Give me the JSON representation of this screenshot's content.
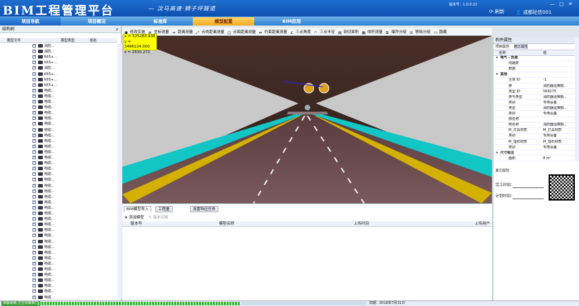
{
  "header": {
    "logo": "BIM工程管理平台",
    "slogan": "— 汶马高速·狮子坪隧道",
    "version": "版本号：1.0.0.22",
    "refresh": "刷新",
    "user": "成都砼信001",
    "win_min": "—",
    "win_max": "□",
    "win_close": "✕"
  },
  "nav": {
    "tabs": [
      {
        "label": "项目导航"
      },
      {
        "label": "项目概况"
      },
      {
        "label": "标准库"
      },
      {
        "label": "模型配置"
      },
      {
        "label": "BIM应用"
      }
    ],
    "selected": "模型配置"
  },
  "left": {
    "title": "结构树",
    "search": "",
    "cols": [
      "模型文件",
      "模型类型",
      "组名"
    ],
    "rows": [
      "消防...",
      "消防...",
      "K65+...",
      "K65+...",
      "消防...",
      "K65+...",
      "K65+...",
      "K65+...",
      "电缆...",
      "电缆...",
      "电缆...",
      "电缆...",
      "电缆...",
      "电缆...",
      "电缆...",
      "电缆...",
      "电缆...",
      "电缆...",
      "电缆...",
      "电缆...",
      "电缆...",
      "电缆...",
      "电缆...",
      "电缆...",
      "电缆...",
      "电缆...",
      "电缆...",
      "电缆...",
      "电缆...",
      "电缆...",
      "电缆...",
      "电缆...",
      "电缆...",
      "电缆...",
      "电缆...",
      "电缆...",
      "电缆...",
      "电缆...",
      "电缆...",
      "电缆...",
      "电缆...",
      "电缆...",
      "电缆...",
      "电缆...",
      "电缆...",
      "电缆..."
    ]
  },
  "toolbar": [
    "修改实施",
    "坐标测量",
    "距离测量",
    "点线距离测量",
    "点面距离测量",
    "约束距离测量",
    "三点角度",
    "三点半径",
    "剖切面积",
    "体积测量",
    "爆炸分组",
    "移除分组",
    "隐藏"
  ],
  "coords": {
    "x": "x = 525283.938",
    "y": "y = 3496124.000",
    "z": "z = 2630.272"
  },
  "props": {
    "panel_title": "构件属性",
    "tabs": [
      "项目属性",
      "施工属性"
    ],
    "cols": [
      "名称",
      "值"
    ],
    "rows": [
      {
        "k": "电气 - 负荷",
        "v": "",
        "g": true
      },
      {
        "k": "线路数",
        "v": ""
      },
      {
        "k": "数据",
        "v": ""
      },
      {
        "k": "其他",
        "v": "",
        "g": true
      },
      {
        "k": "主体 ID",
        "v": "-1"
      },
      {
        "k": "族",
        "v": "消防器遥推额..."
      },
      {
        "k": "类型 ID",
        "v": "569275"
      },
      {
        "k": "族与类型",
        "v": "消防器遥推额..."
      },
      {
        "k": "类别",
        "v": "专用设备"
      },
      {
        "k": "类型",
        "v": "消防器遥推额..."
      },
      {
        "k": "类别",
        "v": "专用设备"
      },
      {
        "k": "族名称",
        "v": ""
      },
      {
        "k": "族名称",
        "v": "消防器遥推额..."
      },
      {
        "k": "M_灯具材质",
        "v": "M_灯具材质"
      },
      {
        "k": "类别",
        "v": "专用设备"
      },
      {
        "k": "M_理石材质",
        "v": "M_理石材质"
      },
      {
        "k": "类别",
        "v": "专用设备"
      },
      {
        "k": "尺寸标注",
        "v": "",
        "g": true
      },
      {
        "k": "面积",
        "v": "8 m²"
      }
    ],
    "other_title": "其它属性",
    "date1_label": "完工时间：",
    "date2_label": "计划时间："
  },
  "bottom": {
    "tabs": [
      "BIM模型导入",
      "工程量",
      "设置特征任务"
    ],
    "add": "添加模型",
    "del": "版本切换",
    "cols": [
      "版本号",
      "模型名称",
      "上传时间",
      "上传用户"
    ]
  },
  "status": {
    "text": "准备就绪 正在加载数据",
    "date": "日期：2018年7月31日",
    "progress": 0.62
  }
}
